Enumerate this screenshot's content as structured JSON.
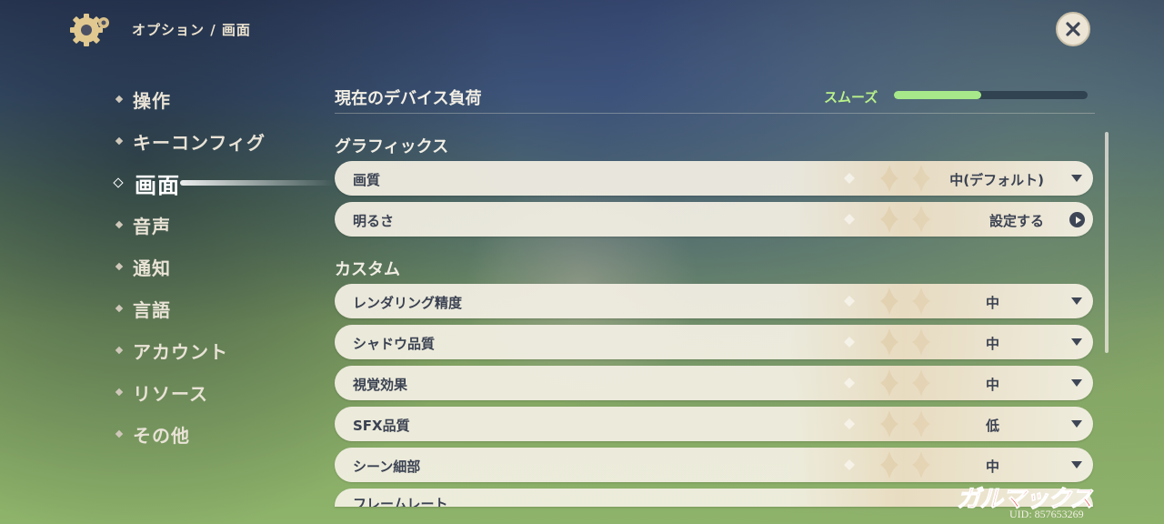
{
  "header": {
    "breadcrumb": "オプション / 画面",
    "settings_icon": "gear-icon",
    "close_icon": "close-icon"
  },
  "sidebar": {
    "items": [
      {
        "label": "操作",
        "active": false
      },
      {
        "label": "キーコンフィグ",
        "active": false
      },
      {
        "label": "画面",
        "active": true
      },
      {
        "label": "音声",
        "active": false
      },
      {
        "label": "通知",
        "active": false
      },
      {
        "label": "言語",
        "active": false
      },
      {
        "label": "アカウント",
        "active": false
      },
      {
        "label": "リソース",
        "active": false
      },
      {
        "label": "その他",
        "active": false
      }
    ]
  },
  "device_load": {
    "title": "現在のデバイス負荷",
    "status": "スムーズ",
    "level": 0.45,
    "color": "#a6e88a"
  },
  "graphics": {
    "title": "グラフィックス",
    "rows": [
      {
        "label": "画質",
        "value": "中(デフォルト)",
        "control": "dropdown"
      },
      {
        "label": "明るさ",
        "value": "設定する",
        "control": "arrow-button"
      }
    ]
  },
  "custom": {
    "title": "カスタム",
    "rows": [
      {
        "label": "レンダリング精度",
        "value": "中",
        "control": "dropdown"
      },
      {
        "label": "シャドウ品質",
        "value": "中",
        "control": "dropdown"
      },
      {
        "label": "視覚効果",
        "value": "中",
        "control": "dropdown"
      },
      {
        "label": "SFX品質",
        "value": "低",
        "control": "dropdown"
      },
      {
        "label": "シーン細部",
        "value": "中",
        "control": "dropdown"
      },
      {
        "label": "フレームレート",
        "value": "",
        "control": "dropdown"
      }
    ]
  },
  "watermark": "ガルマックス",
  "uid": "UID: 857653269"
}
